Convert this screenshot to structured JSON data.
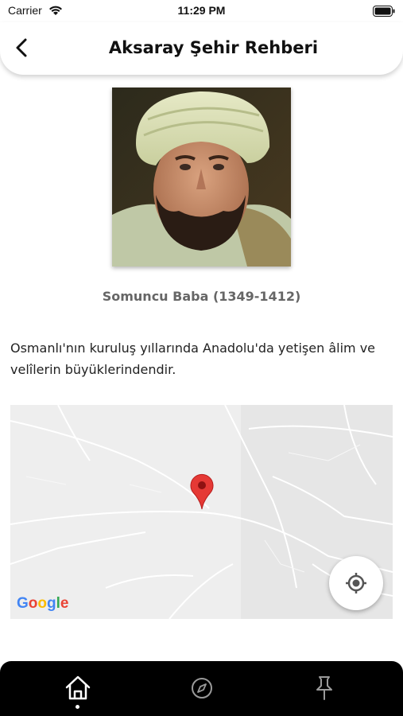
{
  "status_bar": {
    "carrier": "Carrier",
    "time": "11:29 PM"
  },
  "header": {
    "title": "Aksaray Şehir Rehberi",
    "back_icon": "chevron-left-icon"
  },
  "figure": {
    "caption": "Somuncu Baba (1349-1412)"
  },
  "description": "Osmanlı'nın kuruluş yıllarında Anadolu'da yetişen âlim ve velîlerin büyüklerindendir.",
  "map": {
    "logo": "Google",
    "pin_color": "#e53935",
    "locate_icon": "crosshair-icon"
  },
  "tab_bar": {
    "items": [
      {
        "icon": "home-icon",
        "selected": true
      },
      {
        "icon": "compass-icon",
        "selected": false
      },
      {
        "icon": "pin-icon",
        "selected": false
      }
    ]
  }
}
